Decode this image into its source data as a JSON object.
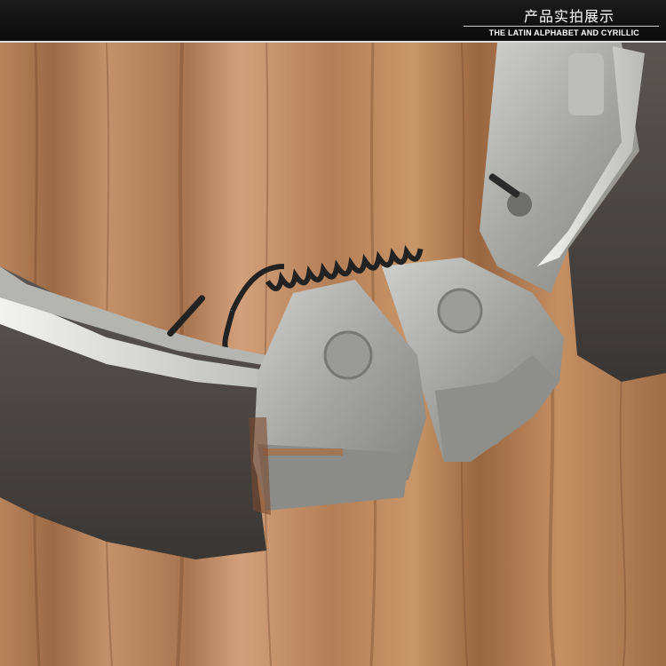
{
  "banner": {
    "title": "产品实拍展示",
    "subtitle": "THE LATIN ALPHABET AND CYRILLIC"
  },
  "colors": {
    "banner_bg": "#111111",
    "wood_light": "#c99465",
    "wood_dark": "#8a5a36",
    "lining": "#4a4542",
    "metal": "#a9a9a6",
    "spring": "#2a2a2a"
  }
}
